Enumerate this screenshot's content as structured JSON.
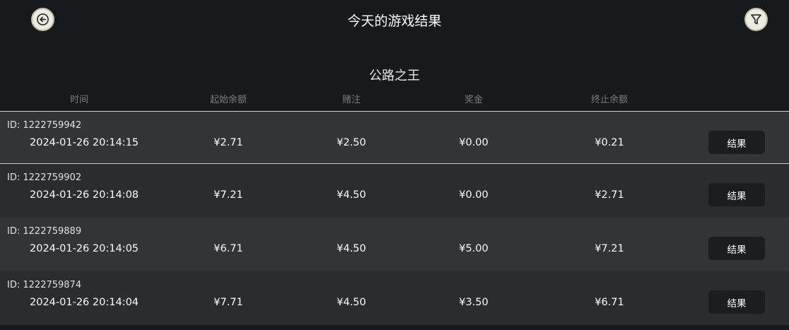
{
  "header": {
    "title": "今天的游戏结果",
    "back_icon": "arrow-left-icon",
    "filter_icon": "filter-icon"
  },
  "game": {
    "name": "公路之王"
  },
  "columns": {
    "time": "时间",
    "start_balance": "起始余额",
    "bet": "赌注",
    "prize": "奖金",
    "end_balance": "终止余额"
  },
  "rows": [
    {
      "id_label": "ID:",
      "id": "1222759942",
      "date": "2024-01-26",
      "time": "20:14:15",
      "start_balance": "¥2.71",
      "bet": "¥2.50",
      "prize": "¥0.00",
      "end_balance": "¥0.21",
      "button": "结果"
    },
    {
      "id_label": "ID:",
      "id": "1222759902",
      "date": "2024-01-26",
      "time": "20:14:08",
      "start_balance": "¥7.21",
      "bet": "¥4.50",
      "prize": "¥0.00",
      "end_balance": "¥2.71",
      "button": "结果"
    },
    {
      "id_label": "ID:",
      "id": "1222759889",
      "date": "2024-01-26",
      "time": "20:14:05",
      "start_balance": "¥6.71",
      "bet": "¥4.50",
      "prize": "¥5.00",
      "end_balance": "¥7.21",
      "button": "结果"
    },
    {
      "id_label": "ID:",
      "id": "1222759874",
      "date": "2024-01-26",
      "time": "20:14:04",
      "start_balance": "¥7.71",
      "bet": "¥4.50",
      "prize": "¥3.50",
      "end_balance": "¥6.71",
      "button": "结果"
    }
  ]
}
